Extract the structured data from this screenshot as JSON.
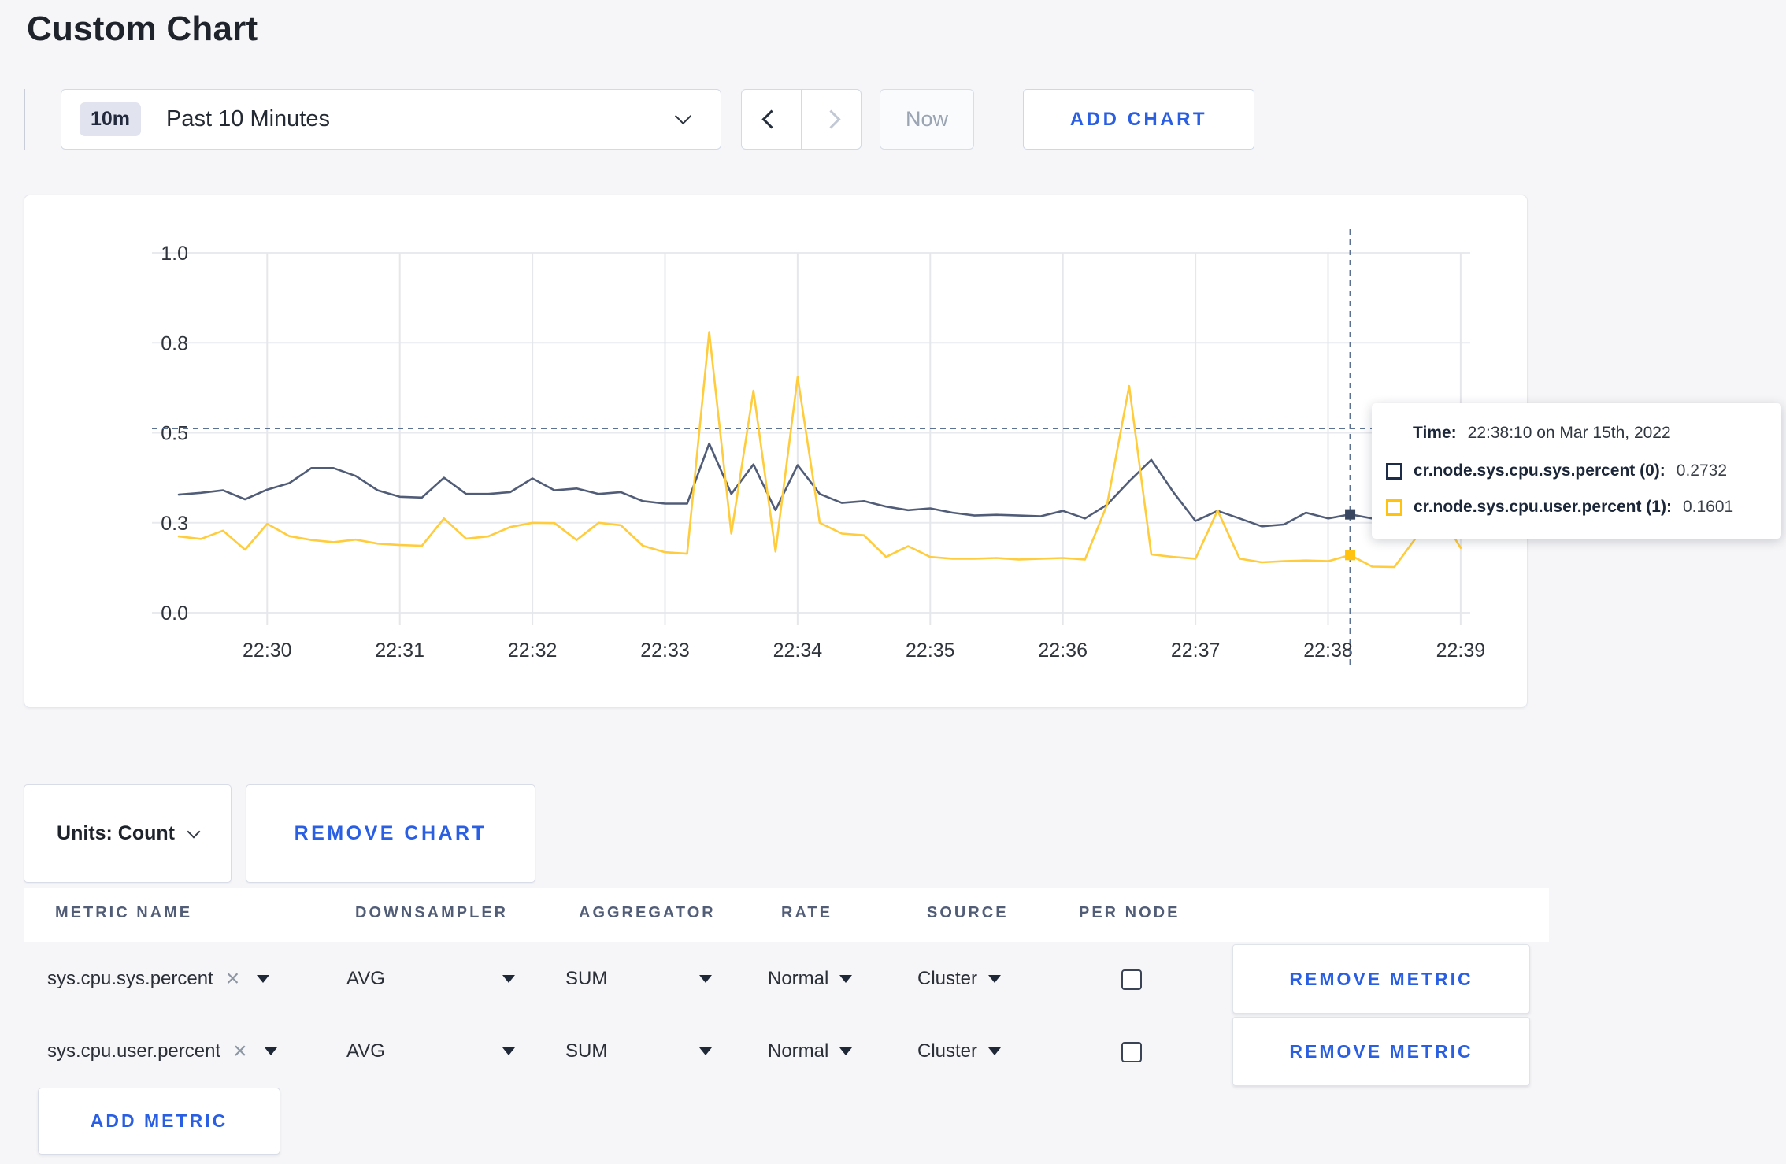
{
  "page": {
    "title": "Custom Chart"
  },
  "toolbar": {
    "time_range": {
      "badge": "10m",
      "label": "Past 10 Minutes"
    },
    "now_label": "Now",
    "add_chart_label": "ADD CHART"
  },
  "chart_data": {
    "type": "line",
    "x_axis": {
      "tick_labels": [
        "22:30",
        "22:31",
        "22:32",
        "22:33",
        "22:34",
        "22:35",
        "22:36",
        "22:37",
        "22:38",
        "22:39"
      ]
    },
    "y_axis": {
      "tick_labels": [
        "0.0",
        "0.3",
        "0.5",
        "0.8",
        "1.0"
      ],
      "tick_values": [
        0,
        0.25,
        0.5,
        0.75,
        1.0
      ],
      "range": [
        0,
        1
      ]
    },
    "grid": true,
    "times": [
      "22:29:20",
      "22:29:30",
      "22:29:40",
      "22:29:50",
      "22:30:00",
      "22:30:10",
      "22:30:20",
      "22:30:30",
      "22:30:40",
      "22:30:50",
      "22:31:00",
      "22:31:10",
      "22:31:20",
      "22:31:30",
      "22:31:40",
      "22:31:50",
      "22:32:00",
      "22:32:10",
      "22:32:20",
      "22:32:30",
      "22:32:40",
      "22:32:50",
      "22:33:00",
      "22:33:10",
      "22:33:20",
      "22:33:30",
      "22:33:40",
      "22:33:50",
      "22:34:00",
      "22:34:10",
      "22:34:20",
      "22:34:30",
      "22:34:40",
      "22:34:50",
      "22:35:00",
      "22:35:10",
      "22:35:20",
      "22:35:30",
      "22:35:40",
      "22:35:50",
      "22:36:00",
      "22:36:10",
      "22:36:20",
      "22:36:30",
      "22:36:40",
      "22:36:50",
      "22:37:00",
      "22:37:10",
      "22:37:20",
      "22:37:30",
      "22:37:40",
      "22:37:50",
      "22:38:00",
      "22:38:10",
      "22:38:20",
      "22:38:30",
      "22:38:40",
      "22:38:50",
      "22:39:00"
    ],
    "series": [
      {
        "name": "cr.node.sys.cpu.sys.percent",
        "node": "(0)",
        "color": "#515d78",
        "dot_color": "#39465f",
        "values": [
          0.328,
          0.333,
          0.34,
          0.315,
          0.342,
          0.36,
          0.402,
          0.402,
          0.38,
          0.34,
          0.322,
          0.32,
          0.375,
          0.33,
          0.33,
          0.335,
          0.373,
          0.34,
          0.345,
          0.33,
          0.335,
          0.31,
          0.303,
          0.303,
          0.47,
          0.33,
          0.412,
          0.285,
          0.41,
          0.33,
          0.305,
          0.31,
          0.295,
          0.285,
          0.29,
          0.278,
          0.27,
          0.272,
          0.27,
          0.268,
          0.283,
          0.262,
          0.3,
          0.365,
          0.425,
          0.335,
          0.255,
          0.283,
          0.262,
          0.24,
          0.245,
          0.278,
          0.262,
          0.2732,
          0.262,
          0.28,
          0.31,
          0.33,
          0.305
        ]
      },
      {
        "name": "cr.node.sys.cpu.user.percent",
        "node": "(1)",
        "color": "#ffcc3d",
        "dot_color": "#ffc30f",
        "values": [
          0.212,
          0.205,
          0.228,
          0.175,
          0.247,
          0.213,
          0.202,
          0.196,
          0.203,
          0.192,
          0.188,
          0.186,
          0.262,
          0.206,
          0.212,
          0.238,
          0.25,
          0.249,
          0.202,
          0.25,
          0.243,
          0.186,
          0.168,
          0.164,
          0.78,
          0.22,
          0.617,
          0.17,
          0.655,
          0.25,
          0.22,
          0.215,
          0.155,
          0.185,
          0.155,
          0.15,
          0.15,
          0.152,
          0.148,
          0.15,
          0.152,
          0.148,
          0.3,
          0.63,
          0.162,
          0.155,
          0.15,
          0.284,
          0.15,
          0.14,
          0.143,
          0.145,
          0.143,
          0.1601,
          0.128,
          0.127,
          0.21,
          0.28,
          0.18
        ]
      }
    ],
    "crosshair": {
      "time": "22:38:10",
      "y_value": 0.512
    }
  },
  "tooltip": {
    "time_label": "Time:",
    "time_value": "22:38:10 on Mar 15th, 2022",
    "rows": [
      {
        "label": "cr.node.sys.cpu.sys.percent (0):",
        "value": "0.2732",
        "color": "#1c2b47"
      },
      {
        "label": "cr.node.sys.cpu.user.percent (1):",
        "value": "0.1601",
        "color": "#ffc20e"
      }
    ]
  },
  "chart_controls": {
    "units_label": "Units: Count",
    "remove_chart_label": "REMOVE CHART"
  },
  "metrics_table": {
    "headers": [
      "METRIC NAME",
      "DOWNSAMPLER",
      "AGGREGATOR",
      "RATE",
      "SOURCE",
      "PER NODE"
    ],
    "rows": [
      {
        "metric": "sys.cpu.sys.percent",
        "downsampler": "AVG",
        "aggregator": "SUM",
        "rate": "Normal",
        "source": "Cluster",
        "per_node_checked": false,
        "remove_label": "REMOVE METRIC"
      },
      {
        "metric": "sys.cpu.user.percent",
        "downsampler": "AVG",
        "aggregator": "SUM",
        "rate": "Normal",
        "source": "Cluster",
        "per_node_checked": false,
        "remove_label": "REMOVE METRIC"
      }
    ],
    "add_metric_label": "ADD METRIC"
  }
}
